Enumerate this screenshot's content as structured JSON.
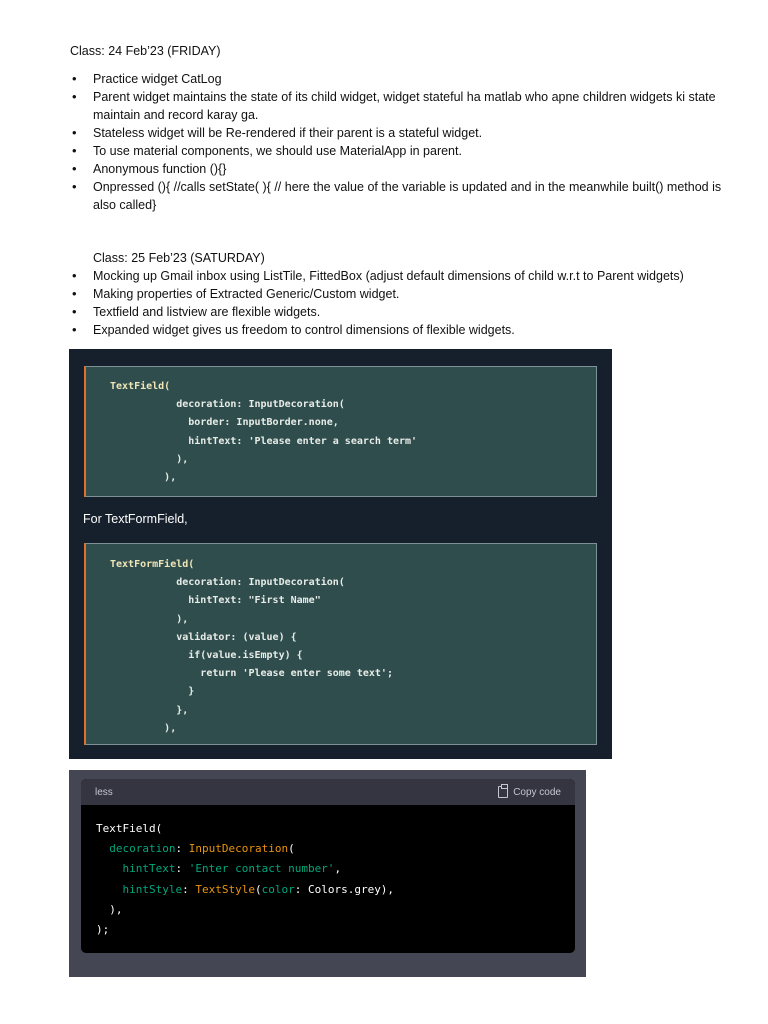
{
  "class1": {
    "heading": "Class: 24 Feb’23 (FRIDAY)",
    "bullets": [
      "Practice widget CatLog",
      "Parent widget maintains the state of its child widget, widget stateful ha matlab who apne children widgets ki state maintain and record karay ga.",
      "Stateless widget will be Re-rendered if their parent is a stateful widget.",
      "To use material components, we should use MaterialApp in parent.",
      "Anonymous function (){}",
      "Onpressed (){ //calls setState( ){ // here the value of the variable is updated and in the meanwhile built() method is also called}"
    ]
  },
  "class2": {
    "heading": "Class: 25 Feb’23 (SATURDAY)",
    "bullets": [
      "Mocking up Gmail inbox using ListTile, FittedBox (adjust default dimensions of child w.r.t to Parent widgets)",
      "Making properties of Extracted Generic/Custom widget.",
      "Textfield and listview are flexible widgets.",
      "Expanded widget gives us freedom to control dimensions of flexible widgets."
    ]
  },
  "code1": {
    "lines": [
      "TextField(",
      "           decoration: InputDecoration(",
      "             border: InputBorder.none,",
      "             hintText: 'Please enter a search term'",
      "           ),",
      "         ),"
    ]
  },
  "for_label": "For TextFormField,",
  "code2": {
    "lines": [
      "TextFormField(",
      "           decoration: InputDecoration(",
      "             hintText: \"First Name\"",
      "           ),",
      "           validator: (value) {",
      "             if(value.isEmpty) {",
      "               return 'Please enter some text';",
      "             }",
      "           },",
      "         ),"
    ]
  },
  "code3": {
    "language": "less",
    "copy_label": "Copy code",
    "lines": [
      [
        [
          "plain",
          "TextField("
        ]
      ],
      [
        [
          "plain",
          "  "
        ],
        [
          "prop",
          "decoration"
        ],
        [
          "plain",
          ": "
        ],
        [
          "class",
          "InputDecoration"
        ],
        [
          "plain",
          "("
        ]
      ],
      [
        [
          "plain",
          "    "
        ],
        [
          "prop",
          "hintText"
        ],
        [
          "plain",
          ": "
        ],
        [
          "str",
          "'Enter contact number'"
        ],
        [
          "plain",
          ","
        ]
      ],
      [
        [
          "plain",
          "    "
        ],
        [
          "prop",
          "hintStyle"
        ],
        [
          "plain",
          ": "
        ],
        [
          "class",
          "TextStyle"
        ],
        [
          "plain",
          "("
        ],
        [
          "prop",
          "color"
        ],
        [
          "plain",
          ": Colors.grey),"
        ]
      ],
      [
        [
          "plain",
          "  ),"
        ]
      ],
      [
        [
          "plain",
          ");"
        ]
      ]
    ]
  }
}
